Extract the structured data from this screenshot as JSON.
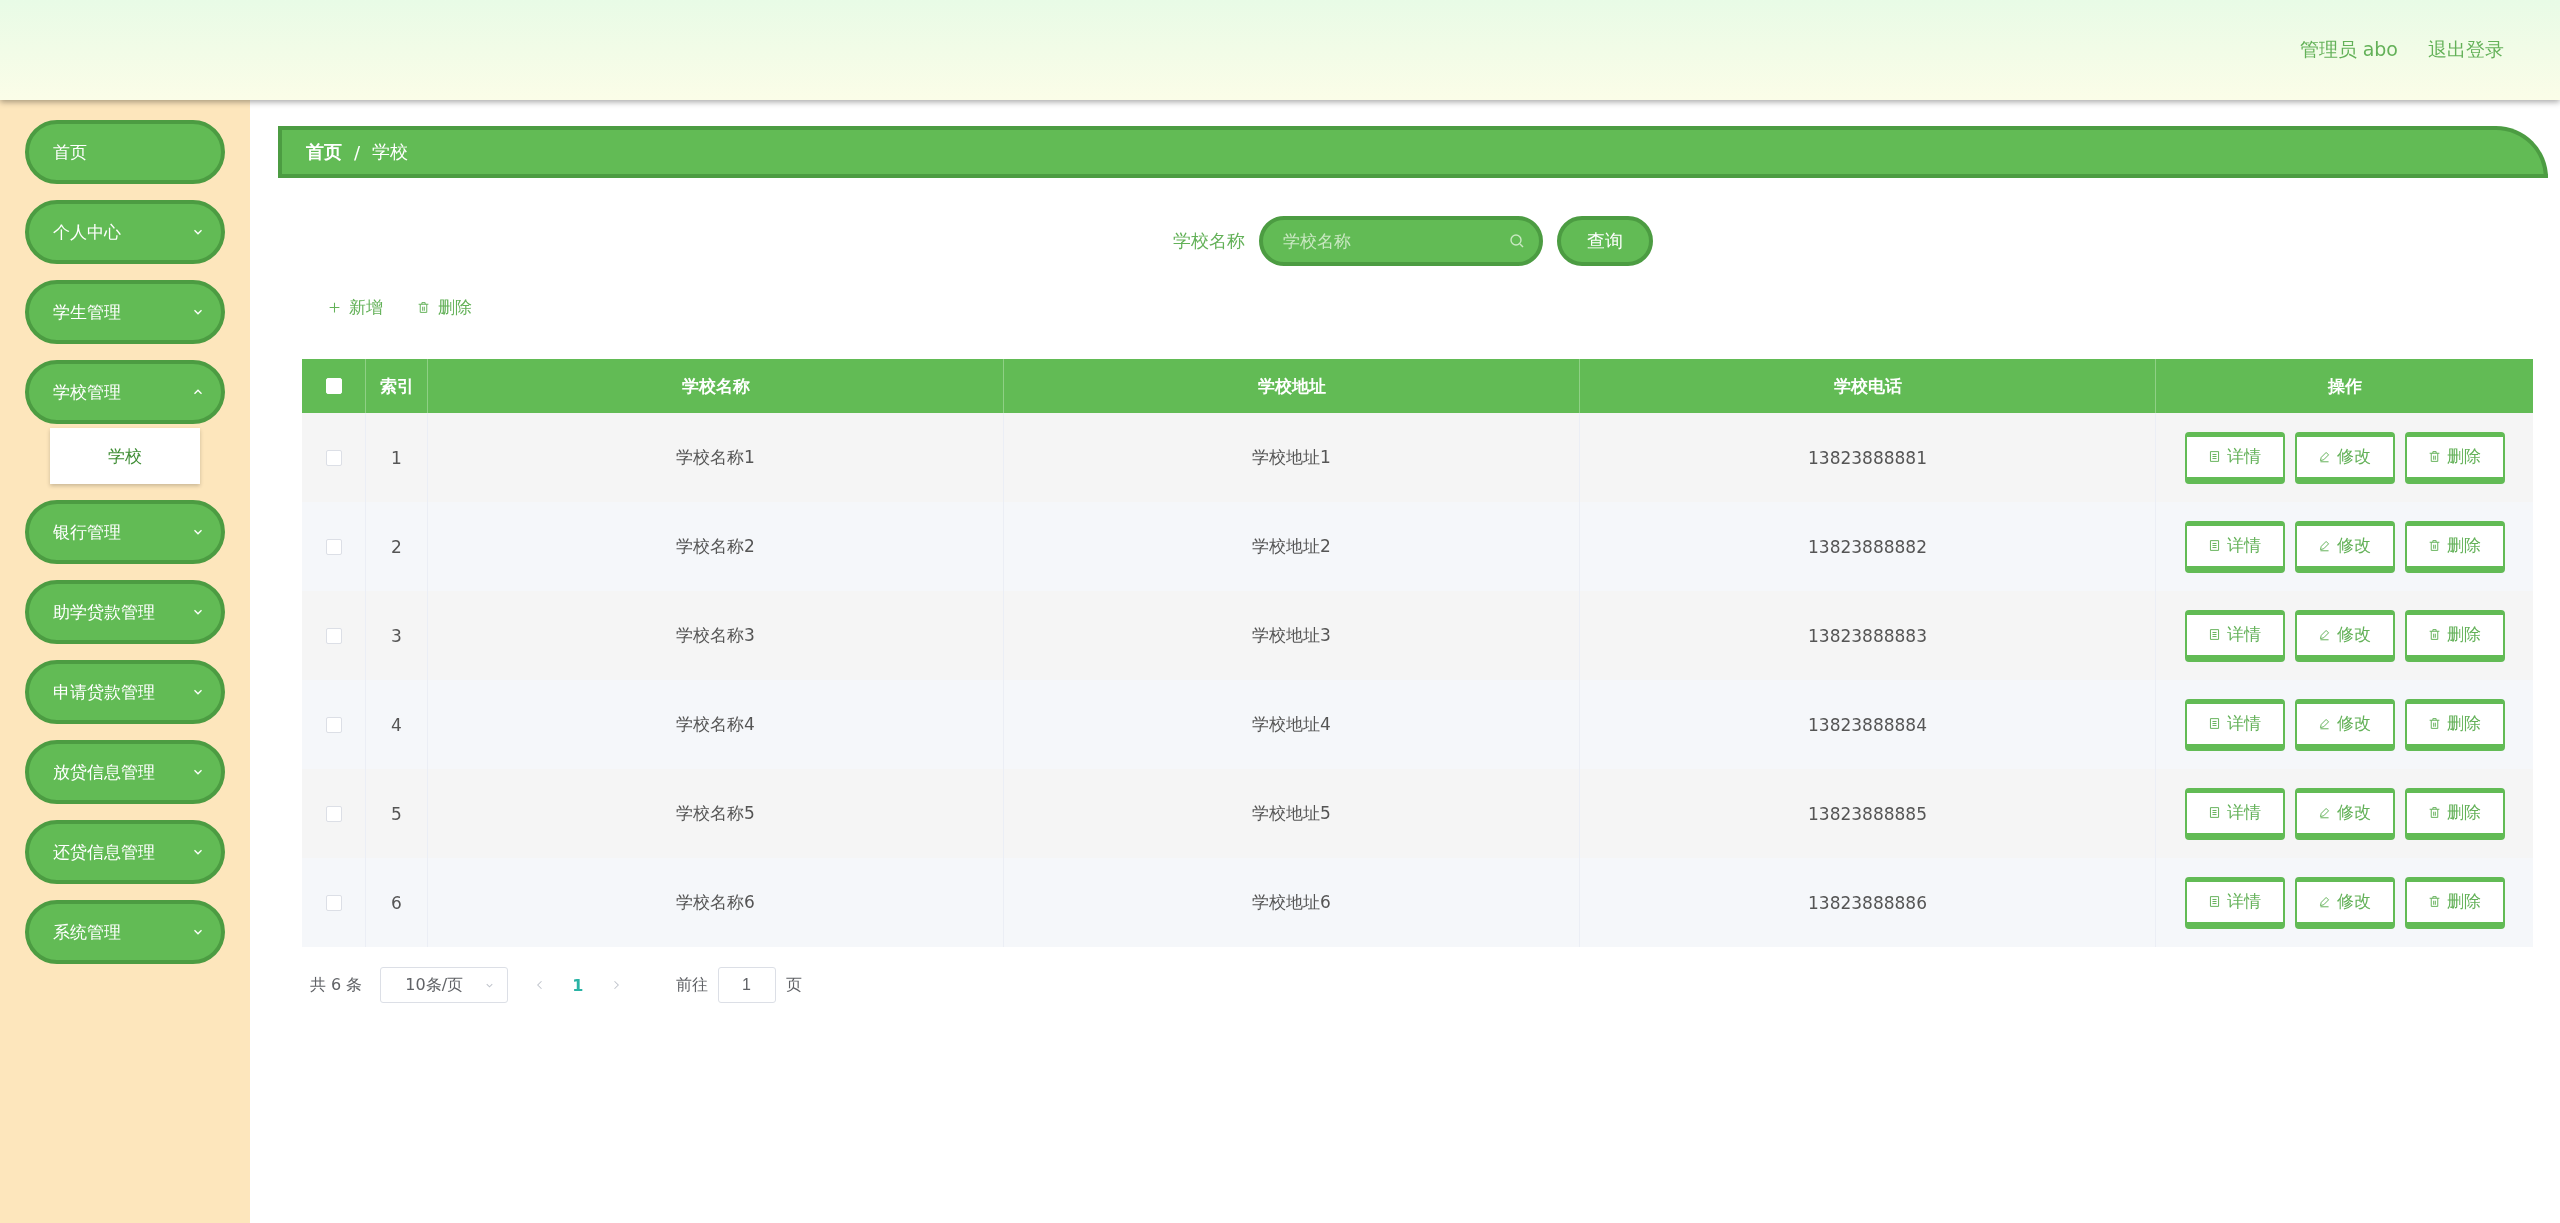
{
  "header": {
    "user_label": "管理员 abo",
    "logout": "退出登录"
  },
  "sidebar": {
    "items": [
      {
        "label": "首页",
        "selected": false
      },
      {
        "label": "个人中心",
        "selected": false,
        "expanded": false
      },
      {
        "label": "学生管理",
        "selected": false,
        "expanded": false
      },
      {
        "label": "学校管理",
        "selected": false,
        "expanded": true,
        "children": [
          {
            "label": "学校",
            "selected": true
          }
        ]
      },
      {
        "label": "银行管理",
        "selected": false,
        "expanded": false
      },
      {
        "label": "助学贷款管理",
        "selected": false,
        "expanded": false
      },
      {
        "label": "申请贷款管理",
        "selected": false,
        "expanded": false
      },
      {
        "label": "放贷信息管理",
        "selected": false,
        "expanded": false
      },
      {
        "label": "还贷信息管理",
        "selected": false,
        "expanded": false
      },
      {
        "label": "系统管理",
        "selected": false,
        "expanded": false
      }
    ]
  },
  "breadcrumb": [
    "首页",
    "学校"
  ],
  "breadcrumb_separator": "/",
  "search": {
    "label": "学校名称",
    "placeholder": "学校名称",
    "button": "查询"
  },
  "actions": [
    {
      "kind": "add",
      "label": "新增"
    },
    {
      "kind": "delete",
      "label": "删除"
    }
  ],
  "table": {
    "header_checked": false,
    "columns": [
      "索引",
      "学校名称",
      "学校地址",
      "学校电话",
      "操作"
    ],
    "rows": [
      {
        "checked": false,
        "cells": [
          "1",
          "学校名称1",
          "学校地址1",
          "13823888881"
        ],
        "actions": [
          {
            "kind": "detail",
            "label": "详情"
          },
          {
            "kind": "edit",
            "label": "修改"
          },
          {
            "kind": "delete",
            "label": "删除"
          }
        ]
      },
      {
        "checked": false,
        "cells": [
          "2",
          "学校名称2",
          "学校地址2",
          "13823888882"
        ],
        "actions": [
          {
            "kind": "detail",
            "label": "详情"
          },
          {
            "kind": "edit",
            "label": "修改"
          },
          {
            "kind": "delete",
            "label": "删除"
          }
        ]
      },
      {
        "checked": false,
        "cells": [
          "3",
          "学校名称3",
          "学校地址3",
          "13823888883"
        ],
        "actions": [
          {
            "kind": "detail",
            "label": "详情"
          },
          {
            "kind": "edit",
            "label": "修改"
          },
          {
            "kind": "delete",
            "label": "删除"
          }
        ]
      },
      {
        "checked": false,
        "cells": [
          "4",
          "学校名称4",
          "学校地址4",
          "13823888884"
        ],
        "actions": [
          {
            "kind": "detail",
            "label": "详情"
          },
          {
            "kind": "edit",
            "label": "修改"
          },
          {
            "kind": "delete",
            "label": "删除"
          }
        ]
      },
      {
        "checked": false,
        "cells": [
          "5",
          "学校名称5",
          "学校地址5",
          "13823888885"
        ],
        "actions": [
          {
            "kind": "detail",
            "label": "详情"
          },
          {
            "kind": "edit",
            "label": "修改"
          },
          {
            "kind": "delete",
            "label": "删除"
          }
        ]
      },
      {
        "checked": false,
        "cells": [
          "6",
          "学校名称6",
          "学校地址6",
          "13823888886"
        ],
        "actions": [
          {
            "kind": "detail",
            "label": "详情"
          },
          {
            "kind": "edit",
            "label": "修改"
          },
          {
            "kind": "delete",
            "label": "删除"
          }
        ]
      }
    ]
  },
  "pagination": {
    "total": "共 6 条",
    "page_size": "10条/页",
    "pages": [
      {
        "label": "1",
        "selected": true
      }
    ],
    "goto_label": "前往",
    "goto_value": "1",
    "goto_suffix": "页"
  }
}
